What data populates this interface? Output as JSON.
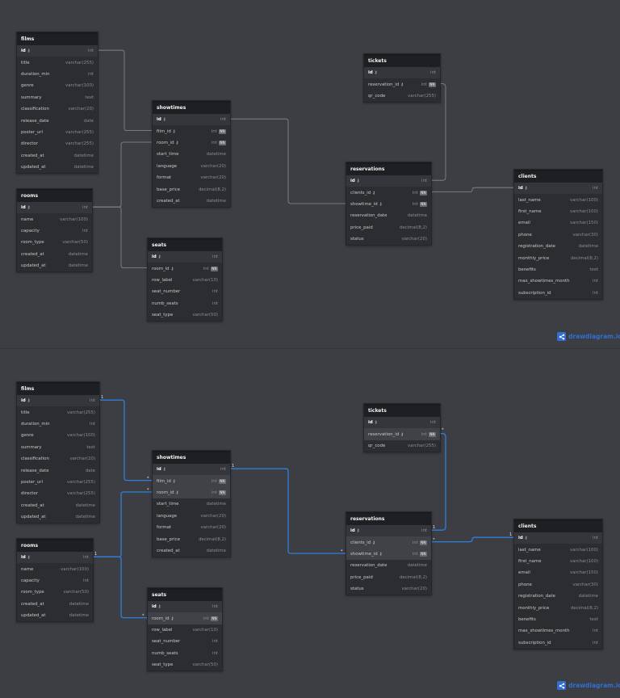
{
  "brand": {
    "name": "drawdiagram.io"
  },
  "colors": {
    "background": "#3d3e43",
    "table": "#2c2d31",
    "header": "#1e1f22",
    "highlight": "#2f7fd8",
    "line": "#8a8b90"
  },
  "icons": {
    "key": "key-icon",
    "brand": "share-icon"
  },
  "nn_label": "NN",
  "cardinality": {
    "one": "1",
    "many": "*"
  },
  "tables": {
    "films": {
      "name": "films",
      "fields": [
        {
          "name": "id",
          "type": "int",
          "pk": true
        },
        {
          "name": "title",
          "type": "varchar(255)"
        },
        {
          "name": "duration_min",
          "type": "int"
        },
        {
          "name": "genre",
          "type": "varchar(100)"
        },
        {
          "name": "summary",
          "type": "text"
        },
        {
          "name": "classification",
          "type": "varchar(20)"
        },
        {
          "name": "release_date",
          "type": "date"
        },
        {
          "name": "poster_url",
          "type": "varchar(255)"
        },
        {
          "name": "director",
          "type": "varchar(255)"
        },
        {
          "name": "created_at",
          "type": "datetime"
        },
        {
          "name": "updated_at",
          "type": "datetime"
        }
      ]
    },
    "rooms": {
      "name": "rooms",
      "fields": [
        {
          "name": "id",
          "type": "int",
          "pk": true
        },
        {
          "name": "name",
          "type": "varchar(100)"
        },
        {
          "name": "capacity",
          "type": "int"
        },
        {
          "name": "room_type",
          "type": "varchar(50)"
        },
        {
          "name": "created_at",
          "type": "datetime"
        },
        {
          "name": "updated_at",
          "type": "datetime"
        }
      ]
    },
    "showtimes": {
      "name": "showtimes",
      "fields": [
        {
          "name": "id",
          "type": "int",
          "pk": true
        },
        {
          "name": "film_id",
          "type": "int",
          "fk": true,
          "nn": true
        },
        {
          "name": "room_id",
          "type": "int",
          "fk": true,
          "nn": true
        },
        {
          "name": "start_time",
          "type": "datetime"
        },
        {
          "name": "language",
          "type": "varchar(20)"
        },
        {
          "name": "format",
          "type": "varchar(20)"
        },
        {
          "name": "base_price",
          "type": "decimal(8,2)"
        },
        {
          "name": "created_at",
          "type": "datetime"
        }
      ]
    },
    "seats": {
      "name": "seats",
      "fields": [
        {
          "name": "id",
          "type": "int",
          "pk": true
        },
        {
          "name": "room_id",
          "type": "int",
          "fk": true,
          "nn": true
        },
        {
          "name": "row_label",
          "type": "varchar(10)"
        },
        {
          "name": "seat_number",
          "type": "int"
        },
        {
          "name": "numb_seats",
          "type": "int"
        },
        {
          "name": "seat_type",
          "type": "varchar(50)"
        }
      ]
    },
    "tickets": {
      "name": "tickets",
      "fields": [
        {
          "name": "id",
          "type": "int",
          "pk": true
        },
        {
          "name": "reservation_id",
          "type": "int",
          "fk": true,
          "nn": true
        },
        {
          "name": "qr_code",
          "type": "varchar(255)"
        }
      ]
    },
    "reservations": {
      "name": "reservations",
      "fields": [
        {
          "name": "id",
          "type": "int",
          "pk": true
        },
        {
          "name": "clients_id",
          "type": "int",
          "fk": true,
          "nn": true
        },
        {
          "name": "showtime_id",
          "type": "int",
          "fk": true,
          "nn": true
        },
        {
          "name": "reservation_date",
          "type": "datetime"
        },
        {
          "name": "price_paid",
          "type": "decimal(8,2)"
        },
        {
          "name": "status",
          "type": "varchar(20)"
        }
      ]
    },
    "clients": {
      "name": "clients",
      "fields": [
        {
          "name": "id",
          "type": "int",
          "pk": true
        },
        {
          "name": "last_name",
          "type": "varchar(100)"
        },
        {
          "name": "first_name",
          "type": "varchar(100)"
        },
        {
          "name": "email",
          "type": "varchar(150)"
        },
        {
          "name": "phone",
          "type": "varchar(30)"
        },
        {
          "name": "registration_date",
          "type": "datetime"
        },
        {
          "name": "monthly_price",
          "type": "decimal(8,2)"
        },
        {
          "name": "benefits",
          "type": "text"
        },
        {
          "name": "max_showtimes_month",
          "type": "int"
        },
        {
          "name": "subscription_id",
          "type": "int"
        }
      ]
    }
  }
}
